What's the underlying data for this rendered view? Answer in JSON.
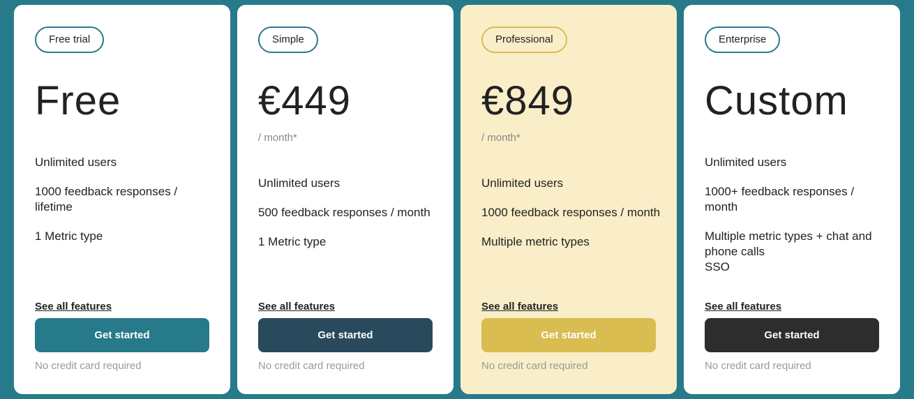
{
  "colors": {
    "background": "#277a8a"
  },
  "plans": [
    {
      "badge": "Free trial",
      "price": "Free",
      "sub": "",
      "features": [
        "Unlimited users",
        "1000 feedback responses / lifetime",
        "1 Metric type"
      ],
      "link": "See all features",
      "button": "Get started",
      "button_color": "#277a8a",
      "note": "No credit card required"
    },
    {
      "badge": "Simple",
      "price": "€449",
      "sub": "/ month*",
      "features": [
        "Unlimited users",
        "500 feedback responses / month",
        "1 Metric type"
      ],
      "link": "See all features",
      "button": "Get started",
      "button_color": "#284a5c",
      "note": "No credit card required"
    },
    {
      "badge": "Professional",
      "price": "€849",
      "sub": "/ month*",
      "features": [
        "Unlimited users",
        "1000 feedback responses / month",
        "Multiple metric types"
      ],
      "link": "See all features",
      "button": "Get started",
      "button_color": "#d9bd50",
      "note": "No credit card required"
    },
    {
      "badge": "Enterprise",
      "price": "Custom",
      "sub": "",
      "features": [
        "Unlimited users",
        "1000+ feedback responses / month",
        "Multiple metric types + chat and phone calls\nSSO"
      ],
      "link": "See all features",
      "button": "Get started",
      "button_color": "#2d2d2d",
      "note": "No credit card required"
    }
  ]
}
